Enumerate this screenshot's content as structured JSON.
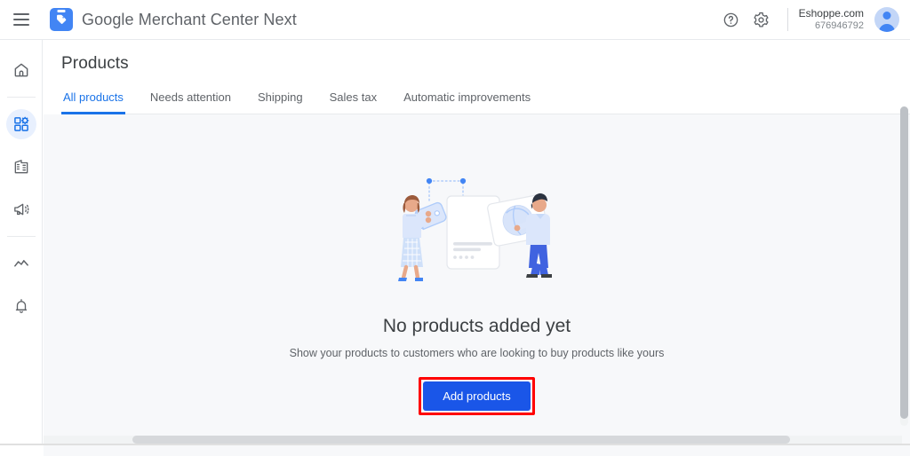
{
  "appbar": {
    "menu_icon": "hamburger-menu-icon",
    "logo_icon": "merchant-center-logo-icon",
    "brand_google": "Google",
    "brand_product": " Merchant Center Next",
    "help_icon": "help-circle-icon",
    "settings_icon": "gear-icon",
    "account_name": "Eshoppe.com",
    "account_id": "676946792",
    "avatar_icon": "user-avatar-icon"
  },
  "sidebar": {
    "items": [
      {
        "name": "home",
        "icon": "home-icon",
        "label": "Home",
        "active": false
      },
      {
        "name": "products",
        "icon": "products-grid-icon",
        "label": "Products",
        "active": true
      },
      {
        "name": "store",
        "icon": "store-building-icon",
        "label": "Your business",
        "active": false
      },
      {
        "name": "marketing",
        "icon": "megaphone-icon",
        "label": "Marketing",
        "active": false
      },
      {
        "name": "performance",
        "icon": "trending-line-icon",
        "label": "Performance",
        "active": false
      },
      {
        "name": "notifications",
        "icon": "bell-icon",
        "label": "Notifications",
        "active": false
      }
    ]
  },
  "page": {
    "title": "Products",
    "tabs": [
      {
        "label": "All products",
        "active": true
      },
      {
        "label": "Needs attention",
        "active": false
      },
      {
        "label": "Shipping",
        "active": false
      },
      {
        "label": "Sales tax",
        "active": false
      },
      {
        "label": "Automatic improvements",
        "active": false
      }
    ]
  },
  "empty_state": {
    "illustration_icon": "two-people-with-product-card-illustration",
    "title": "No products added yet",
    "subtitle": "Show your products to customers who are looking to buy products like yours",
    "cta_label": "Add products"
  },
  "colors": {
    "accent_blue": "#1a73e8",
    "button_blue": "#1a56e8",
    "highlight_red": "#ff0000",
    "content_bg": "#f7f8fa",
    "text_primary": "#3c4043",
    "text_secondary": "#5f6368"
  },
  "scrollbars": {
    "vertical_name": "vertical-scrollbar",
    "horizontal_name": "horizontal-scrollbar"
  }
}
